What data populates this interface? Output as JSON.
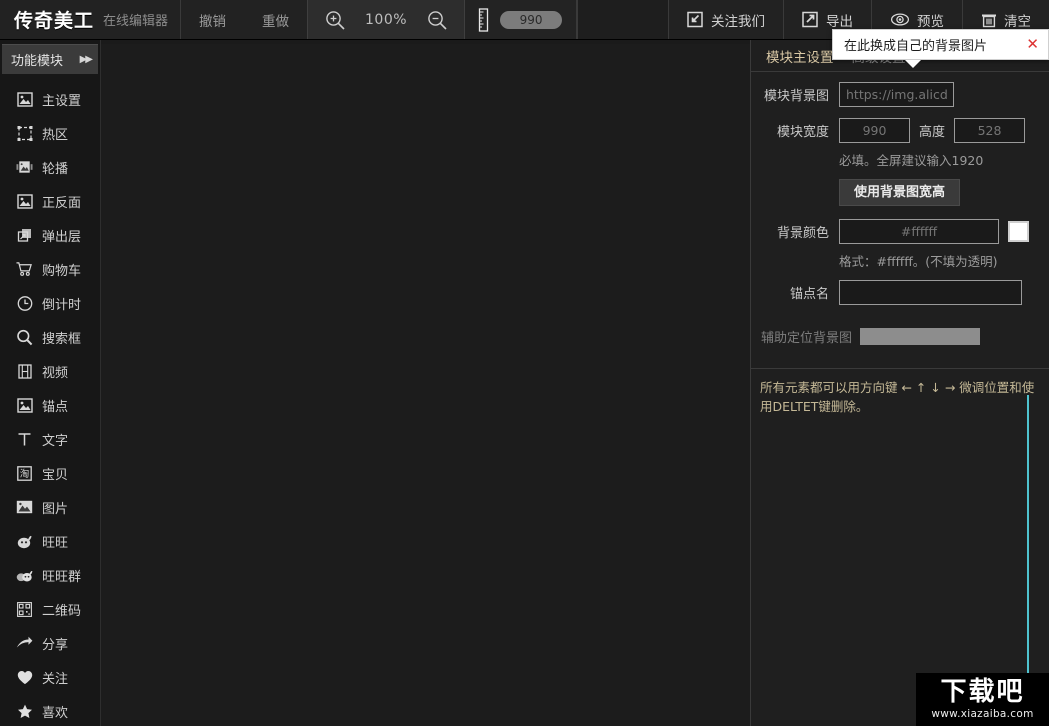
{
  "toolbar": {
    "brand_logo": "传奇美工",
    "brand_sub": "在线编辑器",
    "undo": "撤销",
    "redo": "重做",
    "zoom_percent": "100%",
    "ruler_value": "990",
    "follow_us": "关注我们",
    "export": "导出",
    "preview": "预览",
    "clear": "清空",
    "icons": {
      "zoom_in": "zoom-in-icon",
      "zoom_out": "zoom-out-icon",
      "ruler": "ruler-icon",
      "follow": "follow-icon",
      "export": "export-icon",
      "preview": "eye-icon",
      "clear": "trash-icon"
    }
  },
  "sidebar": {
    "header": "功能模块",
    "header_arrows": "▶▶",
    "items": [
      {
        "label": "主设置",
        "icon": "image-settings-icon"
      },
      {
        "label": "热区",
        "icon": "hotspot-icon"
      },
      {
        "label": "轮播",
        "icon": "carousel-icon"
      },
      {
        "label": "正反面",
        "icon": "flip-image-icon"
      },
      {
        "label": "弹出层",
        "icon": "popup-layer-icon"
      },
      {
        "label": "购物车",
        "icon": "cart-icon"
      },
      {
        "label": "倒计时",
        "icon": "clock-icon"
      },
      {
        "label": "搜索框",
        "icon": "search-icon"
      },
      {
        "label": "视频",
        "icon": "video-icon"
      },
      {
        "label": "锚点",
        "icon": "anchor-image-icon"
      },
      {
        "label": "文字",
        "icon": "text-icon"
      },
      {
        "label": "宝贝",
        "icon": "taobao-item-icon"
      },
      {
        "label": "图片",
        "icon": "picture-icon"
      },
      {
        "label": "旺旺",
        "icon": "wangwang-icon"
      },
      {
        "label": "旺旺群",
        "icon": "wangwang-group-icon"
      },
      {
        "label": "二维码",
        "icon": "qrcode-icon"
      },
      {
        "label": "分享",
        "icon": "share-arrow-icon"
      },
      {
        "label": "关注",
        "icon": "heart-icon"
      },
      {
        "label": "喜欢",
        "icon": "star-icon"
      }
    ]
  },
  "panel": {
    "tabs": [
      {
        "label": "模块主设置",
        "active": true
      },
      {
        "label": "高级设置",
        "active": false
      }
    ],
    "tab_arrows": "▶▶",
    "fields": {
      "bg_image_label": "模块背景图",
      "bg_image_placeholder": "https://img.alicdn.com",
      "width_label": "模块宽度",
      "width_value": "990",
      "height_label": "高度",
      "height_value": "528",
      "size_hint": "必填。全屏建议输入1920",
      "use_bg_size_button": "使用背景图宽高",
      "bg_color_label": "背景颜色",
      "bg_color_value": "#ffffff",
      "bg_color_swatch": "#ffffff",
      "color_hint": "格式：#ffffff。(不填为透明)",
      "anchor_label": "锚点名",
      "anchor_value": "",
      "aux_bg_label": "辅助定位背景图"
    },
    "note": "所有元素都可以用方向键 ← ↑ ↓ → 微调位置和使用DELTET键删除。"
  },
  "tooltip": {
    "text": "在此换成自己的背景图片",
    "close_icon": "close-icon",
    "close_glyph": "✕"
  },
  "watermark": {
    "title": "下载吧",
    "url": "www.xiazaiba.com"
  }
}
